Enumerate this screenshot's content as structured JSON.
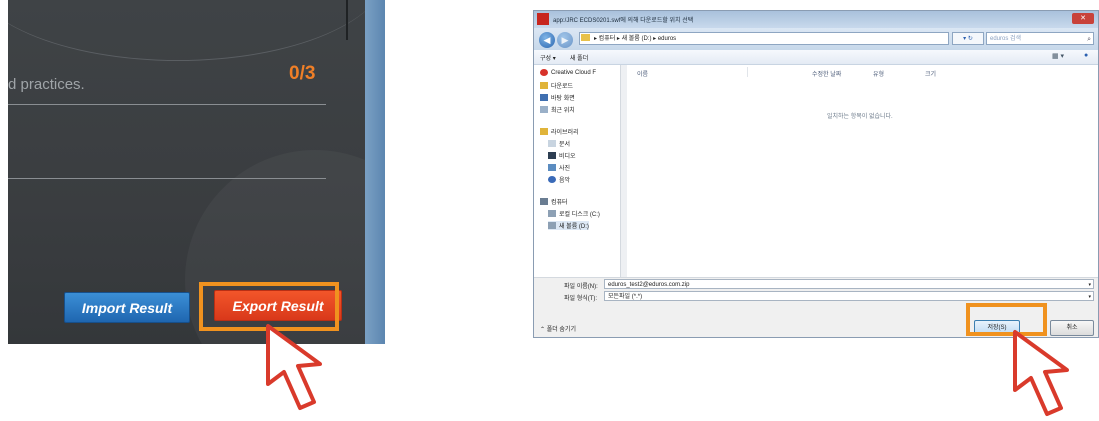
{
  "left_app": {
    "practices_text": "d practices.",
    "score": "0/3",
    "import_button": "Import Result",
    "export_button": "Export Result",
    "accent_color": "#f07f27"
  },
  "dialog": {
    "title": "app:/JRC ECDS0201.swf에 의해 다운로드할 위치 선택",
    "close_symbol": "✕",
    "address": "▸ 컴퓨터 ▸ 새 볼륨 (D:) ▸ eduros",
    "refresh_symbol": "▾ ↻",
    "search_placeholder": "eduros 검색",
    "toolbar": {
      "organize": "구성 ▾",
      "new_folder": "새 폴더"
    },
    "nav_items": [
      "Creative Cloud F",
      "다운로드",
      "바탕 화면",
      "최근 위치",
      "라이브러리",
      "문서",
      "비디오",
      "사진",
      "음악",
      "컴퓨터",
      "로컬 디스크 (C:)",
      "새 볼륨 (D:)"
    ],
    "columns": {
      "name": "이름",
      "modified": "수정한 날짜",
      "type": "유형",
      "size": "크기"
    },
    "empty_message": "일치하는 항목이 없습니다.",
    "filename_label": "파일 이름(N):",
    "filename_value": "eduros_test2@eduros.com.zip",
    "filetype_label": "파일 형식(T):",
    "filetype_value": "모든파일 (*.*)",
    "hide_folders": "폴더 숨기기",
    "save_button": "저장(S)",
    "cancel_button": "취소"
  }
}
